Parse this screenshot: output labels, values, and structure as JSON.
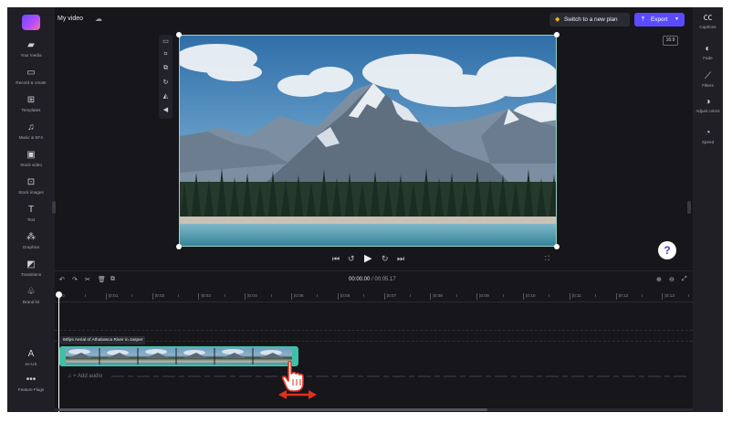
{
  "app": {
    "project_title": "My video"
  },
  "left_rail": {
    "items": [
      {
        "label": "Your media",
        "icon": "folder-icon",
        "glyph": "▰"
      },
      {
        "label": "Record & create",
        "icon": "record-icon",
        "glyph": "▭"
      },
      {
        "label": "Templates",
        "icon": "templates-icon",
        "glyph": "⊞"
      },
      {
        "label": "Music & SFX",
        "icon": "music-icon",
        "glyph": "♫"
      },
      {
        "label": "Stock video",
        "icon": "film-icon",
        "glyph": "▣"
      },
      {
        "label": "Stock images",
        "icon": "image-icon",
        "glyph": "⊡"
      },
      {
        "label": "Text",
        "icon": "text-icon",
        "glyph": "T"
      },
      {
        "label": "Graphics",
        "icon": "shapes-icon",
        "glyph": "⁂"
      },
      {
        "label": "Transitions",
        "icon": "transitions-icon",
        "glyph": "◩"
      },
      {
        "label": "Brand kit",
        "icon": "brand-kit-icon",
        "glyph": "♧"
      }
    ],
    "bottom_items": [
      {
        "label": "en-US",
        "icon": "language-icon",
        "glyph": "A"
      },
      {
        "label": "Feature Flags",
        "icon": "more-icon",
        "glyph": "•••"
      }
    ]
  },
  "top_bar": {
    "upgrade_label": "Switch to a new plan",
    "export_label": "Export",
    "accent_color": "#5b4bff",
    "gem_color": "#f4b400"
  },
  "right_rail": {
    "items": [
      {
        "label": "Captions",
        "icon": "captions-icon",
        "glyph": "㏄"
      },
      {
        "label": "Fade",
        "icon": "fade-icon",
        "glyph": "◐"
      },
      {
        "label": "Filters",
        "icon": "filters-icon",
        "glyph": "⟋"
      },
      {
        "label": "Adjust colors",
        "icon": "adjust-colors-icon",
        "glyph": "◑"
      },
      {
        "label": "Speed",
        "icon": "speed-icon",
        "glyph": "◔"
      }
    ]
  },
  "preview": {
    "aspect_ratio": "16:9"
  },
  "timeline": {
    "current_time": "00:00.00",
    "separator": " / ",
    "duration": "00:05.17",
    "ticks": [
      "0",
      "|0:01",
      "|0:02",
      "|0:03",
      "|0:04",
      "|0:05",
      "|0:06",
      "|0:07",
      "|0:08",
      "|0:09",
      "|0:10",
      "|0:11",
      "|0:12",
      "|0:13"
    ],
    "clip_title": "60fps Aerial of Athabasca River in Jasper",
    "add_audio_label": "+ Add audio",
    "clip_color": "#3fc1a6"
  }
}
